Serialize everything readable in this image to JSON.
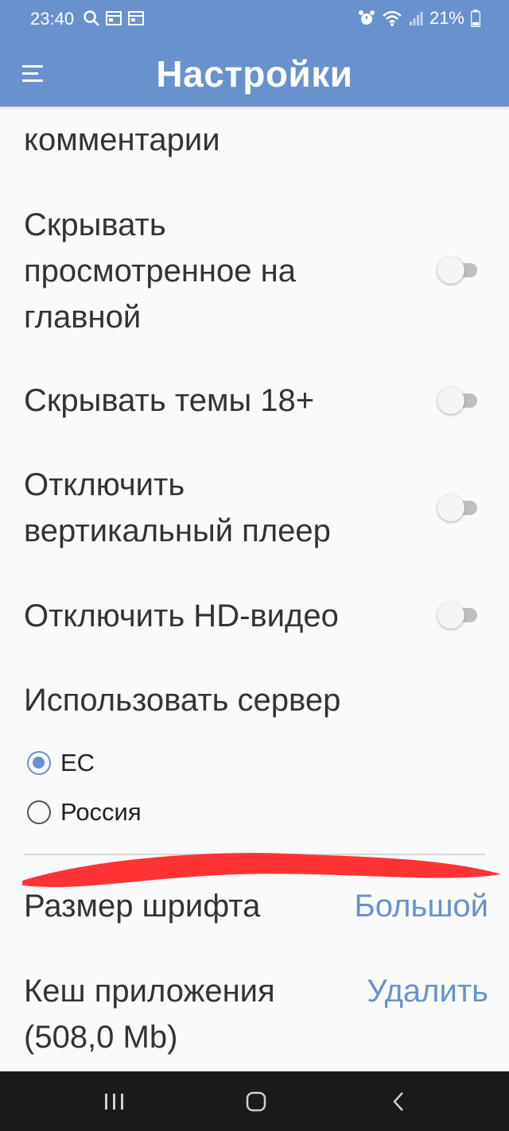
{
  "status_bar": {
    "time": "23:40",
    "battery": "21%"
  },
  "app_bar": {
    "title": "Настройки"
  },
  "settings": {
    "partial_item": "комментарии",
    "hide_viewed": "Скрывать\nпросмотренное на\nглавной",
    "hide_18": "Скрывать темы 18+",
    "disable_vertical_player": "Отключить\nвертикальный плеер",
    "disable_hd": "Отключить HD-видео",
    "server_label": "Использовать сервер",
    "server_options": [
      "ЕС",
      "Россия"
    ],
    "server_selected": "ЕС",
    "font_size_label": "Размер шрифта",
    "font_size_value": "Большой",
    "cache_label": "Кеш приложения\n(508,0 Mb)",
    "cache_action": "Удалить"
  },
  "colors": {
    "accent": "#6891ce",
    "annotation": "#ff3333"
  }
}
